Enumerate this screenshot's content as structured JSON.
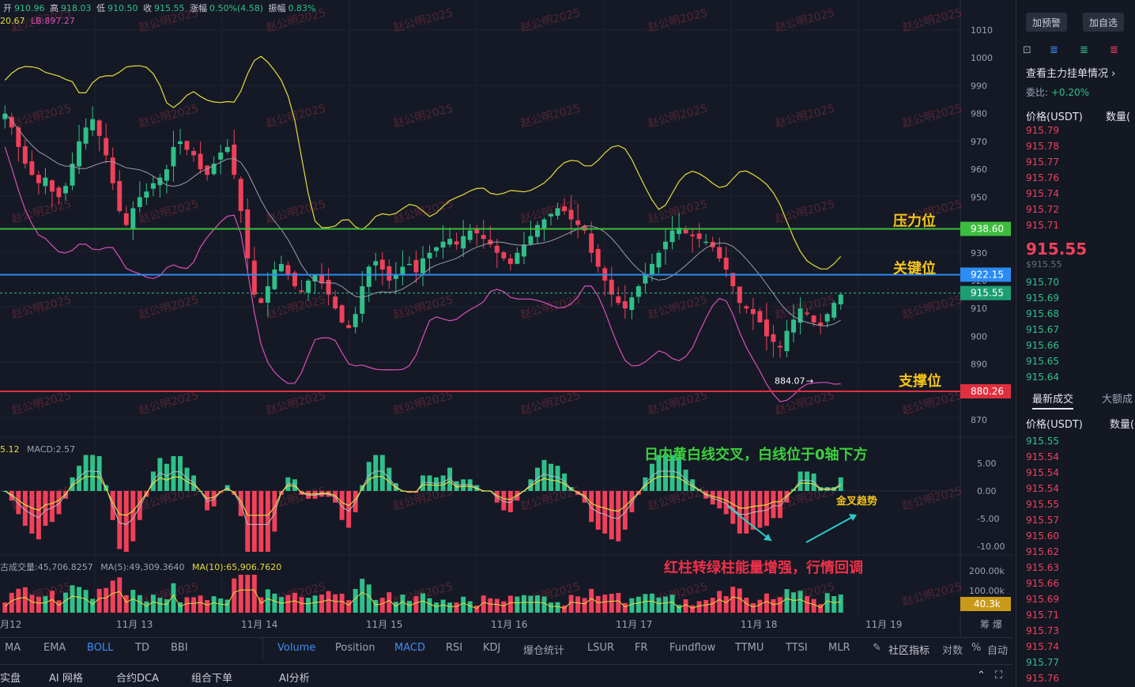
{
  "header": {
    "open_label": "开",
    "open": "910.96",
    "high_label": "高",
    "high": "918.03",
    "low_label": "低",
    "low": "910.50",
    "close_label": "收",
    "close": "915.55",
    "change_label": "涨幅",
    "change": "0.50%(4.58)",
    "amplitude_label": "振幅",
    "amplitude": "0.83%",
    "boll_partial": "20.67",
    "boll_lb": "LB:897.27"
  },
  "macd_legend": {
    "partial": "5.12",
    "macd": "MACD:2.57"
  },
  "volume_legend": {
    "label": "古成交量:45,706.8257",
    "ma5": "MA(5):49,309.3640",
    "ma10": "MA(10):65,906.7620"
  },
  "watermark": "赵公明2025",
  "annotations": {
    "resistance": "压力位",
    "key": "关键位",
    "support": "支撑位",
    "low_marker": "884.07",
    "macd_note": "日内黄白线交叉，白线位于0轴下方",
    "golden_cross": "金叉趋势",
    "volume_note": "红柱转绿柱能量增强，行情回调"
  },
  "price_tags": {
    "resistance": "938.60",
    "key": "922.15",
    "current": "915.55",
    "support": "880.26",
    "volume": "40.3k"
  },
  "colors": {
    "up": "#2fc08a",
    "down": "#f0405a",
    "yellow": "#e5dc3b",
    "pink": "#d94fb8",
    "gray": "#9a9ea9",
    "resistance": "#3dbd3d",
    "key": "#2b8cf5",
    "support": "#e0303f",
    "annotation_yellow": "#f5c518",
    "annotation_green": "#3dd13d",
    "annotation_red": "#f0304a"
  },
  "toolbar": {
    "left_indicators": [
      "MA",
      "EMA",
      "BOLL",
      "TD",
      "BBI"
    ],
    "active_left": "BOLL",
    "right_indicators": [
      "Volume",
      "Position",
      "MACD",
      "RSI",
      "KDJ",
      "爆仓统计",
      "LSUR",
      "FR",
      "Fundflow",
      "TTMU",
      "TTSI",
      "MLR"
    ],
    "active_right": [
      "Volume",
      "MACD"
    ],
    "community": "社区指标",
    "log_label": "对数",
    "percent_label": "%",
    "auto_label": "自动"
  },
  "footer": {
    "items": [
      "实盘",
      "AI 网格",
      "合约DCA",
      "组合下单",
      "AI分析"
    ]
  },
  "side_panel": {
    "alert_button": "加预警",
    "favorite_button": "加自选",
    "depth_link": "查看主力挂单情况",
    "ratio_label": "委比:",
    "ratio_value": "+0.20%",
    "price_header": "价格(USDT)",
    "qty_header": "数量(",
    "asks": [
      "915.79",
      "915.78",
      "915.77",
      "915.76",
      "915.74",
      "915.72",
      "915.71"
    ],
    "last_price": "915.55",
    "last_price_sub": "$915.55",
    "bids": [
      "915.70",
      "915.69",
      "915.68",
      "915.67",
      "915.66",
      "915.65",
      "915.64"
    ],
    "tab_latest": "最新成交",
    "tab_large": "大额成",
    "trades_price_header": "价格(USDT)",
    "trades_qty_header": "数量(",
    "trades": [
      "915.55",
      "915.54",
      "915.54",
      "915.54",
      "915.55",
      "915.57",
      "915.60",
      "915.62",
      "915.63",
      "915.66",
      "915.69",
      "915.71",
      "915.73",
      "915.74",
      "915.77",
      "915.76"
    ]
  },
  "chart_data": {
    "type": "candlestick",
    "price_axis": {
      "ticks": [
        1010,
        1000,
        990,
        980,
        970,
        960,
        950,
        930,
        920,
        910,
        900,
        890,
        870
      ],
      "ylim": [
        865,
        1018
      ]
    },
    "macd_axis": {
      "ticks": [
        "5.00",
        "0.00",
        "-5.00",
        "-10.00"
      ],
      "ylim": [
        -11.5,
        7
      ]
    },
    "volume_axis": {
      "ticks": [
        "200.00k",
        "100.00k"
      ]
    },
    "x_ticks": [
      "月12",
      "11月 13",
      "11月 14",
      "11月 15",
      "11月 16",
      "11月 17",
      "11月 18",
      "11月 19"
    ],
    "levels": {
      "resistance": 938.6,
      "key": 922.15,
      "current": 915.55,
      "support": 880.26
    },
    "low_point": 884.07,
    "price_path": [
      980,
      975,
      968,
      962,
      958,
      955,
      957,
      952,
      950,
      954,
      962,
      970,
      975,
      978,
      972,
      965,
      955,
      945,
      940,
      946,
      950,
      952,
      955,
      957,
      960,
      968,
      970,
      967,
      965,
      960,
      958,
      962,
      966,
      968,
      958,
      945,
      928,
      915,
      912,
      918,
      924,
      926,
      922,
      918,
      916,
      920,
      922,
      919,
      915,
      910,
      905,
      903,
      908,
      918,
      925,
      927,
      924,
      920,
      922,
      925,
      926,
      923,
      928,
      930,
      932,
      934,
      935,
      933,
      936,
      938,
      937,
      935,
      933,
      930,
      928,
      926,
      930,
      933,
      936,
      940,
      942,
      944,
      946,
      945,
      942,
      940,
      938,
      930,
      925,
      920,
      915,
      912,
      910,
      914,
      918,
      922,
      926,
      930,
      934,
      938,
      939,
      937,
      936,
      935,
      934,
      932,
      928,
      924,
      918,
      912,
      910,
      908,
      905,
      900,
      898,
      896,
      902,
      906,
      910,
      908,
      905,
      904,
      908,
      912,
      915
    ]
  }
}
